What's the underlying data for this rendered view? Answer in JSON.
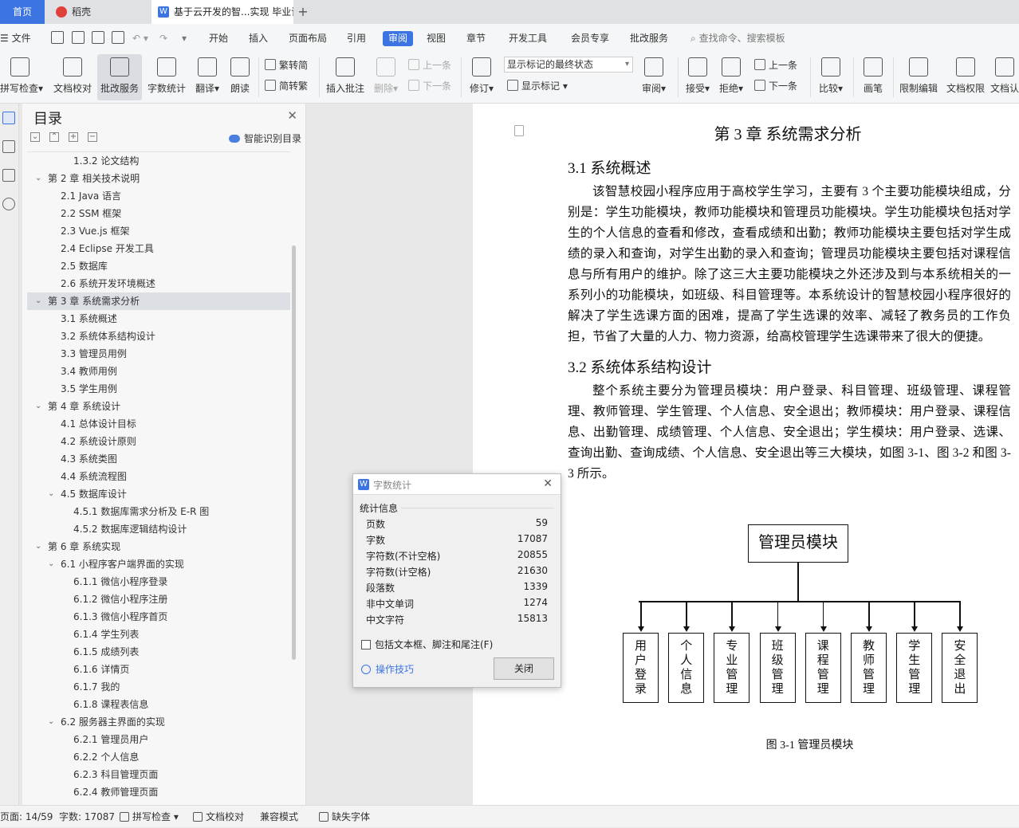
{
  "tabs": {
    "home": "首页",
    "daoke": "稻壳",
    "doc": "基于云开发的智...实现 毕业论文"
  },
  "menu": {
    "file": "文件",
    "items": [
      "开始",
      "插入",
      "页面布局",
      "引用",
      "审阅",
      "视图",
      "章节",
      "开发工具",
      "会员专享",
      "批改服务"
    ],
    "active_index": 4,
    "search": "查找命令、搜索模板"
  },
  "ribbon": {
    "spell": "拼写检查",
    "proof": "文档校对",
    "grade": "批改服务",
    "wordcount": "字数统计",
    "translate": "翻译",
    "read": "朗读",
    "trad": "繁转简",
    "simp": "简转繁",
    "insert_comment": "插入批注",
    "delete": "删除",
    "prev_c": "上一条",
    "next_c": "下一条",
    "revise": "修订",
    "markup_state": "显示标记的最终状态",
    "show_markup": "显示标记",
    "review": "审阅",
    "accept": "接受",
    "reject": "拒绝",
    "prev": "上一条",
    "next": "下一条",
    "compare": "比较",
    "pen": "画笔",
    "restrict": "限制编辑",
    "rights": "文档权限",
    "verify": "文档认"
  },
  "toc": {
    "title": "目录",
    "smart": "智能识别目录",
    "items": [
      {
        "t": "1.3.2 论文结构",
        "l": 3
      },
      {
        "t": "第 2 章 相关技术说明",
        "l": 1,
        "a": "open"
      },
      {
        "t": "2.1 Java 语言",
        "l": 2
      },
      {
        "t": "2.2 SSM 框架",
        "l": 2
      },
      {
        "t": "2.3 Vue.js 框架",
        "l": 2
      },
      {
        "t": "2.4 Eclipse 开发工具",
        "l": 2
      },
      {
        "t": "2.5 数据库",
        "l": 2
      },
      {
        "t": "2.6 系统开发环境概述",
        "l": 2
      },
      {
        "t": "第 3 章 系统需求分析",
        "l": 1,
        "a": "open",
        "sel": true
      },
      {
        "t": "3.1 系统概述",
        "l": 2
      },
      {
        "t": "3.2 系统体系结构设计",
        "l": 2
      },
      {
        "t": "3.3 管理员用例",
        "l": 2
      },
      {
        "t": "3.4 教师用例",
        "l": 2
      },
      {
        "t": "3.5 学生用例",
        "l": 2
      },
      {
        "t": "第 4 章 系统设计",
        "l": 1,
        "a": "open"
      },
      {
        "t": "4.1 总体设计目标",
        "l": 2
      },
      {
        "t": "4.2 系统设计原则",
        "l": 2
      },
      {
        "t": "4.3 系统类图",
        "l": 2
      },
      {
        "t": "4.4 系统流程图",
        "l": 2
      },
      {
        "t": "4.5 数据库设计",
        "l": 2,
        "a": "open"
      },
      {
        "t": "4.5.1 数据库需求分析及 E-R 图",
        "l": 3
      },
      {
        "t": "4.5.2 数据库逻辑结构设计",
        "l": 3
      },
      {
        "t": "第 6 章 系统实现",
        "l": 1,
        "a": "open"
      },
      {
        "t": "6.1 小程序客户端界面的实现",
        "l": 2,
        "a": "open"
      },
      {
        "t": "6.1.1 微信小程序登录",
        "l": 3
      },
      {
        "t": "6.1.2 微信小程序注册",
        "l": 3
      },
      {
        "t": "6.1.3 微信小程序首页",
        "l": 3
      },
      {
        "t": "6.1.4 学生列表",
        "l": 3
      },
      {
        "t": "6.1.5 成绩列表",
        "l": 3
      },
      {
        "t": "6.1.6 详情页",
        "l": 3
      },
      {
        "t": "6.1.7 我的",
        "l": 3
      },
      {
        "t": "6.1.8 课程表信息",
        "l": 3
      },
      {
        "t": "6.2 服务器主界面的实现",
        "l": 2,
        "a": "open"
      },
      {
        "t": "6.2.1 管理员用户",
        "l": 3
      },
      {
        "t": "6.2.2 个人信息",
        "l": 3
      },
      {
        "t": "6.2.3 科目管理页面",
        "l": 3
      },
      {
        "t": "6.2.4 教师管理页面",
        "l": 3
      }
    ]
  },
  "doc": {
    "chapter": "第 3 章  系统需求分析",
    "s31": "3.1 系统概述",
    "p1": "该智慧校园小程序应用于高校学生学习，主要有 3 个主要功能模块组成，分别是：学生功能模块，教师功能模块和管理员功能模块。学生功能模块包括对学生的个人信息的查看和修改，查看成绩和出勤；教师功能模块主要包括对学生成绩的录入和查询，对学生出勤的录入和查询；管理员功能模块主要包括对课程信息与所有用户的维护。除了这三大主要功能模块之外还涉及到与本系统相关的一系列小的功能模块，如班级、科目管理等。本系统设计的智慧校园小程序很好的解决了学生选课方面的困难，提高了学生选课的效率、减轻了教务员的工作负担，节省了大量的人力、物力资源，给高校管理学生选课带来了很大的便捷。",
    "s32": "3.2 系统体系结构设计",
    "p2": "整个系统主要分为管理员模块：用户登录、科目管理、班级管理、课程管理、教师管理、学生管理、个人信息、安全退出；教师模块：用户登录、课程信息、出勤管理、成绩管理、个人信息、安全退出；学生模块：用户登录、选课、查询出勤、查询成绩、个人信息、安全退出等三大模块，如图 3-1、图 3-2 和图 3-3 所示。",
    "diagram": {
      "root": "管理员模块",
      "children": [
        "用户登录",
        "个人信息",
        "专业管理",
        "班级管理",
        "课程管理",
        "教师管理",
        "学生管理",
        "安全退出"
      ]
    },
    "caption": "图 3-1   管理员模块"
  },
  "dialog": {
    "title": "字数统计",
    "section": "统计信息",
    "rows": [
      {
        "k": "页数",
        "v": "59"
      },
      {
        "k": "字数",
        "v": "17087"
      },
      {
        "k": "字符数(不计空格)",
        "v": "20855"
      },
      {
        "k": "字符数(计空格)",
        "v": "21630"
      },
      {
        "k": "段落数",
        "v": "1339"
      },
      {
        "k": "非中文单词",
        "v": "1274"
      },
      {
        "k": "中文字符",
        "v": "15813"
      }
    ],
    "checkbox": "包括文本框、脚注和尾注(F)",
    "tips": "操作技巧",
    "close": "关闭"
  },
  "status": {
    "page": "页面: 14/59",
    "words": "字数: 17087",
    "spell": "拼写检查",
    "proof": "文档校对",
    "compat": "兼容模式",
    "font": "缺失字体"
  },
  "colors": {
    "accent": "#3c74e2"
  }
}
